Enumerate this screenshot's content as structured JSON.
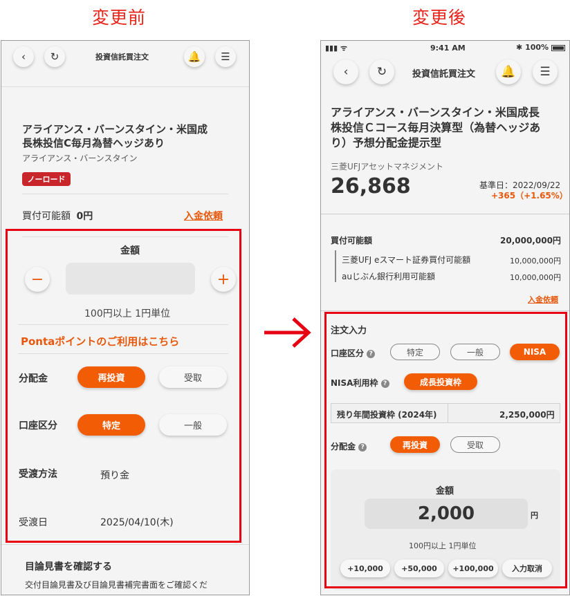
{
  "headings": {
    "before": "変更前",
    "after": "変更後"
  },
  "before": {
    "nav_title": "投資信託買注文",
    "fund_name_line1": "アライアンス・バーンスタイン・米国成",
    "fund_name_line2": "長株投信C毎月為替ヘッジあり",
    "company": "アライアンス・バーンスタイン",
    "badge": "ノーロード",
    "available_label": "買付可能額",
    "available_value": "0円",
    "deposit_link": "入金依頼",
    "amount_label": "金額",
    "minus": "−",
    "plus": "+",
    "amount_hint": "100円以上 1円単位",
    "ponta_link": "Pontaポイントのご利用はこちら",
    "dividend_label": "分配金",
    "dividend_options": [
      "再投資",
      "受取"
    ],
    "account_label": "口座区分",
    "account_options": [
      "特定",
      "一般"
    ],
    "settlement_label": "受渡方法",
    "settlement_value": "預り金",
    "delivery_label": "受渡日",
    "delivery_value": "2025/04/10(木)",
    "prospectus_title": "目論見書を確認する",
    "prospectus_text": "交付目論見書及び目論見書補完書面をご確認くだ"
  },
  "after": {
    "status": {
      "time": "9:41 AM",
      "battery": "100%"
    },
    "nav_title": "投資信託買注文",
    "fund_name_line1": "アライアンス・バーンスタイン・米国成長",
    "fund_name_line2": "株投信Ｃコース毎月決算型（為替ヘッジあ",
    "fund_name_line3": "り）予想分配金提示型",
    "company": "三菱UFJアセットマネジメント",
    "price": "26,868",
    "base_date": "基準日：2022/09/22",
    "change": "+365（+1.65%）",
    "available_label": "買付可能額",
    "available_value": "20,000,000円",
    "sub_rows": [
      {
        "label": "三菱UFJ eスマート証券買付可能額",
        "value": "10,000,000円"
      },
      {
        "label": "auじぶん銀行利用可能額",
        "value": "10,000,000円"
      }
    ],
    "deposit_link": "入金依頼",
    "order_title": "注文入力",
    "account_label": "口座区分",
    "account_options": [
      "特定",
      "一般",
      "NISA"
    ],
    "nisa_label": "NISA利用枠",
    "nisa_option": "成長投資枠",
    "remaining_label": "残り年間投資枠 (2024年)",
    "remaining_value": "2,250,000円",
    "dividend_label": "分配金",
    "dividend_options": [
      "再投資",
      "受取"
    ],
    "amount_label": "金額",
    "amount_value": "2,000",
    "amount_unit": "円",
    "amount_hint": "100円以上 1円単位",
    "quick_buttons": [
      "+10,000",
      "+50,000",
      "+100,000",
      "入力取消"
    ]
  },
  "colors": {
    "accent": "#f25c05",
    "annotation": "#e60012"
  }
}
